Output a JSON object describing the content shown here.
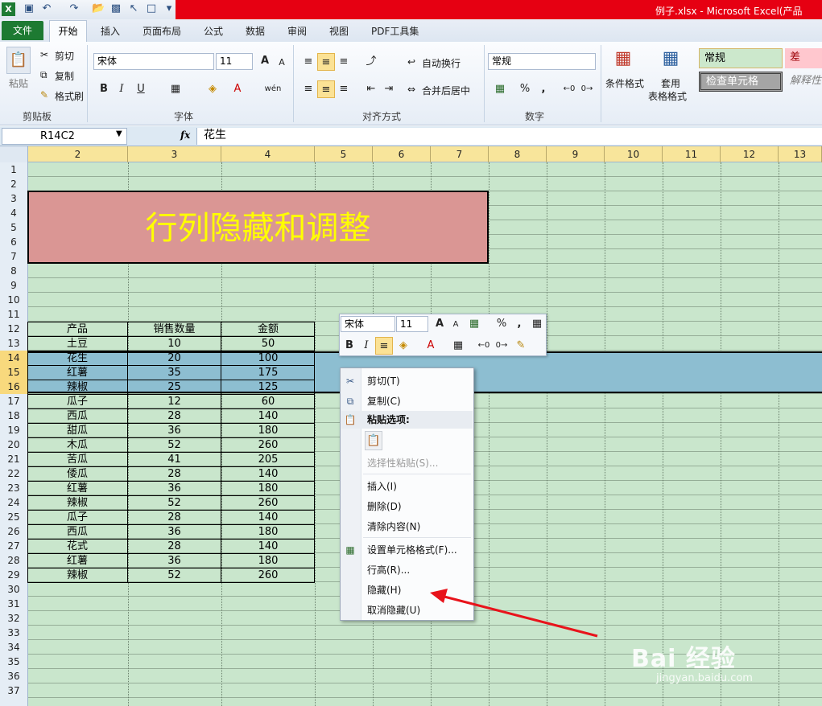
{
  "title": "例子.xlsx - Microsoft Excel(产品",
  "tabs": [
    "文件",
    "开始",
    "插入",
    "页面布局",
    "公式",
    "数据",
    "审阅",
    "视图",
    "PDF工具集"
  ],
  "clipboard": {
    "paste": "粘贴",
    "cut": "剪切",
    "copy": "复制",
    "format_painter": "格式刷",
    "label": "剪贴板"
  },
  "font": {
    "name": "宋体",
    "size": "11",
    "label": "字体",
    "bold": "B",
    "italic": "I",
    "underline": "U",
    "grow": "A",
    "shrink": "A",
    "wen": "wén"
  },
  "alignment": {
    "wrap": "自动换行",
    "merge": "合并后居中",
    "label": "对齐方式"
  },
  "number": {
    "format": "常规",
    "percent": "%",
    "comma": ",",
    "label": "数字"
  },
  "styles": {
    "cond_format": "条件格式",
    "table_format_1": "套用",
    "table_format_2": "表格格式",
    "normal": "常规",
    "bad": "差",
    "check": "检查单元格",
    "explain": "解释性"
  },
  "namebox": "R14C2",
  "fx": "fx",
  "formula_value": "花生",
  "columns": [
    "2",
    "3",
    "4",
    "5",
    "6",
    "7",
    "8",
    "9",
    "10",
    "11",
    "12",
    "13"
  ],
  "rows": [
    "1",
    "2",
    "3",
    "4",
    "5",
    "6",
    "7",
    "8",
    "9",
    "10",
    "11",
    "12",
    "13",
    "14",
    "15",
    "16",
    "17",
    "18",
    "19",
    "20",
    "21",
    "22",
    "23",
    "24",
    "25",
    "26",
    "27",
    "28",
    "29",
    "30",
    "31",
    "32",
    "33",
    "34",
    "35",
    "36",
    "37"
  ],
  "sheet_title": "行列隐藏和调整",
  "table": {
    "headers": [
      "产品",
      "销售数量",
      "金额"
    ],
    "rows": [
      [
        "土豆",
        "10",
        "50"
      ],
      [
        "花生",
        "20",
        "100"
      ],
      [
        "红薯",
        "35",
        "175"
      ],
      [
        "辣椒",
        "25",
        "125"
      ],
      [
        "瓜子",
        "12",
        "60"
      ],
      [
        "西瓜",
        "28",
        "140"
      ],
      [
        "甜瓜",
        "36",
        "180"
      ],
      [
        "木瓜",
        "52",
        "260"
      ],
      [
        "苦瓜",
        "41",
        "205"
      ],
      [
        "倭瓜",
        "28",
        "140"
      ],
      [
        "红薯",
        "36",
        "180"
      ],
      [
        "辣椒",
        "52",
        "260"
      ],
      [
        "瓜子",
        "28",
        "140"
      ],
      [
        "西瓜",
        "36",
        "180"
      ],
      [
        "花式",
        "28",
        "140"
      ],
      [
        "红薯",
        "36",
        "180"
      ],
      [
        "辣椒",
        "52",
        "260"
      ]
    ]
  },
  "minibar": {
    "font": "宋体",
    "size": "11"
  },
  "context_menu": {
    "cut": "剪切(T)",
    "copy": "复制(C)",
    "paste_options": "粘贴选项:",
    "paste_special": "选择性粘贴(S)...",
    "insert": "插入(I)",
    "delete": "删除(D)",
    "clear": "清除内容(N)",
    "format_cells": "设置单元格格式(F)...",
    "row_height": "行高(R)...",
    "hide": "隐藏(H)",
    "unhide": "取消隐藏(U)"
  },
  "watermark": "Bai 经验",
  "watermark_url": "jingyan.baidu.com",
  "colors": {
    "grid": "#c9e6cc",
    "title_fill": "#da9694",
    "title_text": "#ffff00",
    "selection": "#8dbed1",
    "arrow": "#e8131b",
    "file_tab": "#1d7a32"
  }
}
